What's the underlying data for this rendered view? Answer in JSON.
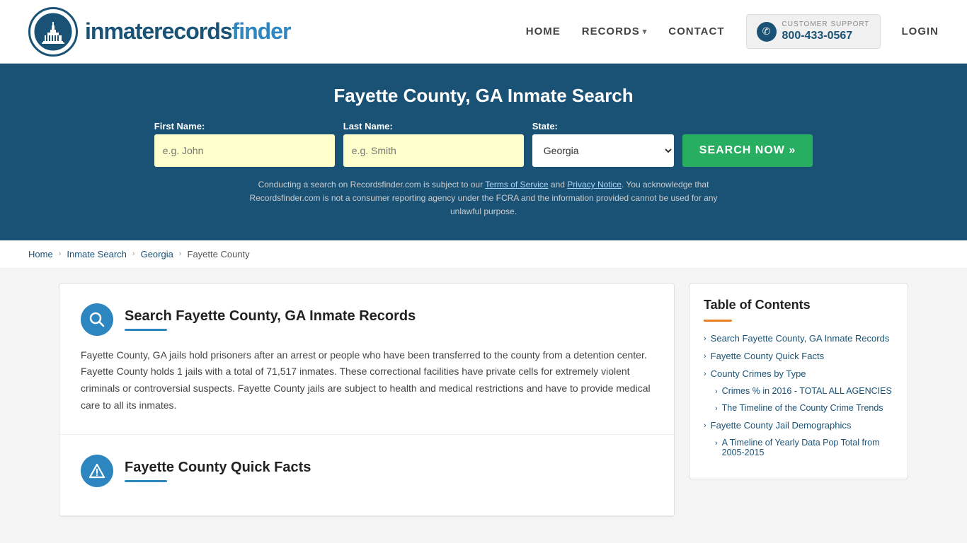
{
  "header": {
    "logo_text_regular": "inmaterecords",
    "logo_text_bold": "finder",
    "nav": {
      "home": "HOME",
      "records": "RECORDS",
      "contact": "CONTACT",
      "login": "LOGIN"
    },
    "support": {
      "label": "CUSTOMER SUPPORT",
      "number": "800-433-0567"
    }
  },
  "hero": {
    "title": "Fayette County, GA Inmate Search",
    "form": {
      "first_name_label": "First Name:",
      "first_name_placeholder": "e.g. John",
      "last_name_label": "Last Name:",
      "last_name_placeholder": "e.g. Smith",
      "state_label": "State:",
      "state_value": "Georgia",
      "search_button": "SEARCH NOW »"
    },
    "disclaimer": "Conducting a search on Recordsfinder.com is subject to our Terms of Service and Privacy Notice. You acknowledge that Recordsfinder.com is not a consumer reporting agency under the FCRA and the information provided cannot be used for any unlawful purpose."
  },
  "breadcrumb": {
    "home": "Home",
    "inmate_search": "Inmate Search",
    "georgia": "Georgia",
    "fayette_county": "Fayette County"
  },
  "sections": {
    "search_section": {
      "title": "Search Fayette County, GA Inmate Records",
      "body": "Fayette County, GA jails hold prisoners after an arrest or people who have been transferred to the county from a detention center. Fayette County holds 1 jails with a total of 71,517 inmates. These correctional facilities have private cells for extremely violent criminals or controversial suspects. Fayette County jails are subject to health and medical restrictions and have to provide medical care to all its inmates."
    },
    "quick_facts": {
      "title": "Fayette County Quick Facts"
    }
  },
  "toc": {
    "title": "Table of Contents",
    "items": [
      {
        "label": "Search Fayette County, GA Inmate Records",
        "sub": false
      },
      {
        "label": "Fayette County Quick Facts",
        "sub": false
      },
      {
        "label": "County Crimes by Type",
        "sub": false
      },
      {
        "label": "Crimes % in 2016 - TOTAL ALL AGENCIES",
        "sub": true
      },
      {
        "label": "The Timeline of the County Crime Trends",
        "sub": true
      },
      {
        "label": "Fayette County Jail Demographics",
        "sub": false
      },
      {
        "label": "A Timeline of Yearly Data Pop Total from 2005-2015",
        "sub": true
      }
    ]
  }
}
